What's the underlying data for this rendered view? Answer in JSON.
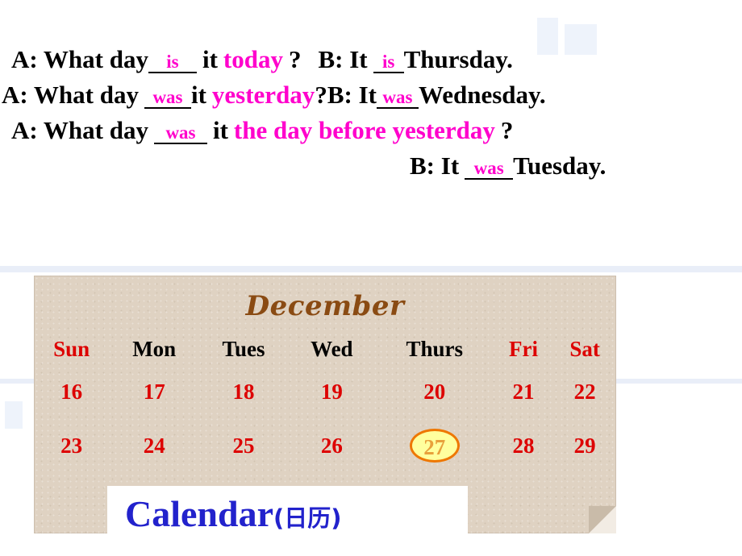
{
  "dialogue": {
    "lines": [
      {
        "id": "line-today",
        "a_prefix": "A: What day",
        "a_blank": "is",
        "a_mid": "it",
        "a_pink": "today",
        "a_suffix": "?",
        "b_prefix": "B: It",
        "b_blank": "is",
        "b_suffix": "Thursday."
      },
      {
        "id": "line-yesterday",
        "a_prefix": "A: What day",
        "a_blank": "was",
        "a_mid": "it",
        "a_pink": "yesterday",
        "a_suffix": "?",
        "b_prefix": "B: It",
        "b_blank": "was",
        "b_suffix": "Wednesday."
      },
      {
        "id": "line-day-before",
        "a_prefix": "A: What day",
        "a_blank": "was",
        "a_mid": "it",
        "a_pink": "the day before yesterday",
        "a_suffix": "?"
      },
      {
        "id": "line-answer-tuesday",
        "b_prefix": "B: It",
        "b_blank": "was",
        "b_suffix": "Tuesday."
      }
    ]
  },
  "calendar": {
    "month": "December",
    "weekdays": [
      "Sun",
      "Mon",
      "Tues",
      "Wed",
      "Thurs",
      "Fri",
      "Sat"
    ],
    "weeks": [
      [
        "16",
        "17",
        "18",
        "19",
        "20",
        "21",
        "22"
      ],
      [
        "23",
        "24",
        "25",
        "26",
        "27",
        "28",
        "29"
      ]
    ],
    "highlighted_day": "27",
    "colors": {
      "month_text": "#8a4b13",
      "weekday_black": "#000000",
      "weekday_red": "#dd0000",
      "date_red": "#dd0000",
      "highlight_fill": "#ffff9e",
      "highlight_border": "#ee7700",
      "paper": "#dfd2c2"
    }
  },
  "label": {
    "english": "Calendar",
    "chinese": "(日历)",
    "color": "#2222cc"
  }
}
